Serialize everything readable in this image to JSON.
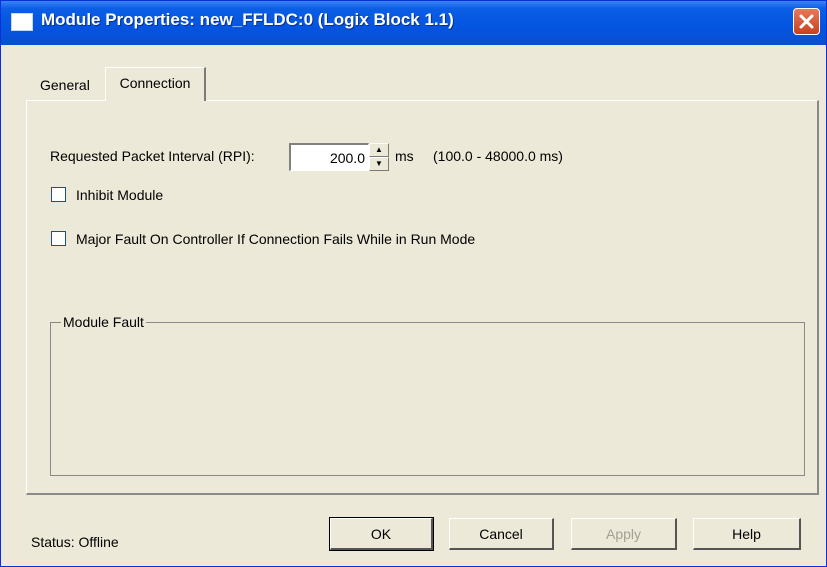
{
  "window": {
    "title": "Module Properties: new_FFLDC:0 (Logix Block 1.1)",
    "title_bar_color": "#0454e0",
    "face_color": "#ece9d8"
  },
  "tabs": [
    {
      "label": "General",
      "active": false
    },
    {
      "label": "Connection",
      "active": true
    }
  ],
  "connection": {
    "rpi_label": "Requested Packet Interval (RPI):",
    "rpi_value": "200.0",
    "rpi_unit": "ms",
    "rpi_range": "(100.0 - 48000.0 ms)",
    "inhibit_label": "Inhibit Module",
    "inhibit_checked": false,
    "major_fault_label": "Major Fault On Controller If Connection Fails While in Run Mode",
    "major_fault_checked": false
  },
  "module_fault": {
    "legend": "Module Fault"
  },
  "footer": {
    "status_text": "Status:  Offline",
    "ok_label": "OK",
    "cancel_label": "Cancel",
    "apply_label": "Apply",
    "help_label": "Help"
  },
  "icons": {
    "close": "close-icon",
    "spin_up": "spin-up-arrow-icon",
    "spin_down": "spin-down-arrow-icon"
  }
}
